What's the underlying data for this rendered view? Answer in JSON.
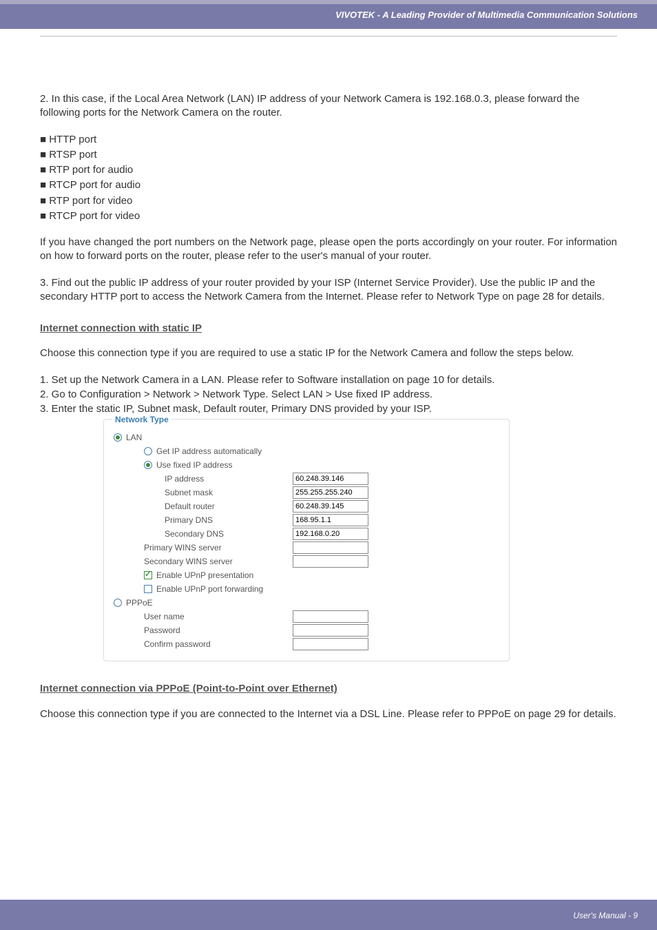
{
  "header": {
    "title": "VIVOTEK - A Leading Provider of Multimedia Communication Solutions"
  },
  "body": {
    "p1": "2. In this case, if the Local Area Network (LAN) IP address of your Network Camera is 192.168.0.3, please forward the following ports for the Network Camera on the router.",
    "bullets": [
      "■ HTTP port",
      "■ RTSP port",
      "■ RTP port for audio",
      "■ RTCP port for audio",
      "■ RTP port for video",
      "■ RTCP port for video"
    ],
    "p2": "If you have changed the port numbers on the Network page, please open the ports accordingly on your router. For information on how to forward ports on the router, please refer to the user's manual of your router.",
    "p3": "3. Find out the public IP address of your router provided by your ISP (Internet Service Provider). Use the public IP and the secondary HTTP port to access the Network Camera from the Internet. Please refer to Network Type on page 28 for details.",
    "h1": "Internet connection with static IP",
    "p4": "Choose this connection type if you are required to use a static IP for the Network Camera and follow the steps below.",
    "steps": [
      "1. Set up the Network Camera in a LAN. Please refer to Software installation on page 10 for details.",
      "2. Go to Configuration > Network > Network Type. Select LAN > Use fixed IP address.",
      "3. Enter the static IP, Subnet mask, Default router, Primary DNS provided by your ISP."
    ],
    "h2": "Internet connection via PPPoE (Point-to-Point over Ethernet)",
    "p5": "Choose this connection type if you are connected to the Internet via a DSL Line. Please refer to PPPoE on page 29 for details."
  },
  "panel": {
    "legend": "Network Type",
    "lan": "LAN",
    "get_auto": "Get IP address automatically",
    "use_fixed": "Use fixed IP address",
    "ip_address_lbl": "IP address",
    "subnet_lbl": "Subnet mask",
    "default_router_lbl": "Default router",
    "primary_dns_lbl": "Primary DNS",
    "secondary_dns_lbl": "Secondary DNS",
    "primary_wins_lbl": "Primary WINS server",
    "secondary_wins_lbl": "Secondary WINS server",
    "upnp_pres": "Enable UPnP presentation",
    "upnp_port": "Enable UPnP port forwarding",
    "pppoe": "PPPoE",
    "user_name": "User name",
    "password": "Password",
    "confirm_password": "Confirm password",
    "values": {
      "ip": "60.248.39.146",
      "subnet": "255.255.255.240",
      "router": "60.248.39.145",
      "pdns": "168.95.1.1",
      "sdns": "192.168.0.20"
    }
  },
  "footer": {
    "text": "User's Manual - 9"
  }
}
